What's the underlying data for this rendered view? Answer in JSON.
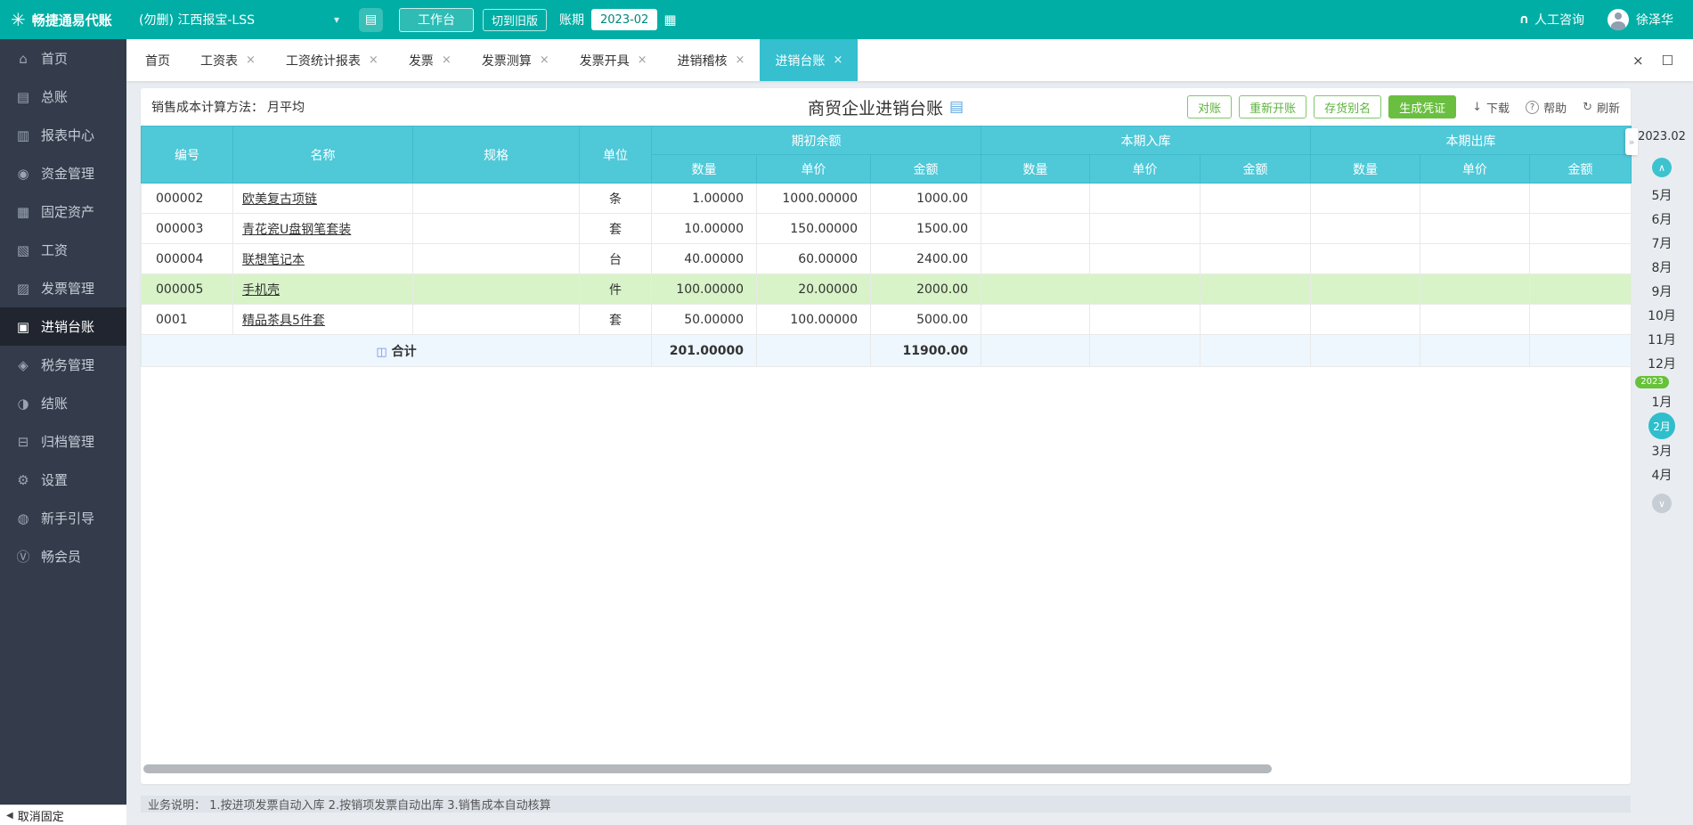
{
  "colors": {
    "brand_teal": "#00aea5",
    "sidebar_dark": "#343c4b",
    "table_header_cyan": "#4fc8d8",
    "active_tab_cyan": "#35bfcf",
    "button_green": "#6abf40",
    "row_highlight_green": "#d7f3c7",
    "total_row_blue": "#edf7fd"
  },
  "icons": {
    "logo": "✳",
    "chevron_down": "▾",
    "note": "▤",
    "calendar": "▦",
    "headset": "∩",
    "close": "×",
    "fullscreen": "☐",
    "download": "↓",
    "help": "?",
    "refresh": "↻",
    "doc": "▤",
    "sum": "◫",
    "collapse": "»",
    "up": "∧",
    "down": "∨",
    "back": "◀"
  },
  "topbar": {
    "logo_text": "畅捷通易代账",
    "company": "(勿删) 江西报宝-LSS",
    "workbench": "工作台",
    "switch_old": "切到旧版",
    "period_label": "账期",
    "period_value": "2023-02",
    "consult": "人工咨询",
    "username": "徐泽华"
  },
  "sidebar": {
    "items": [
      {
        "label": "首页",
        "glyph": "⌂"
      },
      {
        "label": "总账",
        "glyph": "▤"
      },
      {
        "label": "报表中心",
        "glyph": "▥"
      },
      {
        "label": "资金管理",
        "glyph": "◉"
      },
      {
        "label": "固定资产",
        "glyph": "▦"
      },
      {
        "label": "工资",
        "glyph": "▧"
      },
      {
        "label": "发票管理",
        "glyph": "▨"
      },
      {
        "label": "进销台账",
        "glyph": "▣"
      },
      {
        "label": "税务管理",
        "glyph": "◈"
      },
      {
        "label": "结账",
        "glyph": "◑"
      },
      {
        "label": "归档管理",
        "glyph": "⊟"
      },
      {
        "label": "设置",
        "glyph": "⚙"
      },
      {
        "label": "新手引导",
        "glyph": "◍"
      },
      {
        "label": "畅会员",
        "glyph": "Ⓥ"
      }
    ],
    "unpin": "取消固定"
  },
  "tabs": [
    {
      "label": "首页"
    },
    {
      "label": "工资表"
    },
    {
      "label": "工资统计报表"
    },
    {
      "label": "发票"
    },
    {
      "label": "发票测算"
    },
    {
      "label": "发票开具"
    },
    {
      "label": "进销稽核"
    },
    {
      "label": "进销台账"
    }
  ],
  "toolbar": {
    "cost_method_label": "销售成本计算方法：",
    "cost_method_value": "月平均",
    "title": "商贸企业进销台账",
    "btn_reconcile": "对账",
    "btn_reopen": "重新开账",
    "btn_alias": "存货别名",
    "btn_voucher": "生成凭证",
    "download": "下载",
    "help": "帮助",
    "refresh": "刷新"
  },
  "table": {
    "col_code": "编号",
    "col_name": "名称",
    "col_spec": "规格",
    "col_unit": "单位",
    "group_opening": "期初余额",
    "group_in": "本期入库",
    "group_out": "本期出库",
    "sub_qty": "数量",
    "sub_price": "单价",
    "sub_amount": "金额",
    "rows": [
      {
        "code": "000002",
        "name": "欧美复古项链",
        "spec": "",
        "unit": "条",
        "qty": "1.00000",
        "price": "1000.00000",
        "amount": "1000.00"
      },
      {
        "code": "000003",
        "name": "青花瓷U盘钢笔套装",
        "spec": "",
        "unit": "套",
        "qty": "10.00000",
        "price": "150.00000",
        "amount": "1500.00"
      },
      {
        "code": "000004",
        "name": "联想笔记本",
        "spec": "",
        "unit": "台",
        "qty": "40.00000",
        "price": "60.00000",
        "amount": "2400.00"
      },
      {
        "code": "000005",
        "name": "手机壳",
        "spec": "",
        "unit": "件",
        "qty": "100.00000",
        "price": "20.00000",
        "amount": "2000.00"
      },
      {
        "code": "0001",
        "name": "精品茶具5件套",
        "spec": "",
        "unit": "套",
        "qty": "50.00000",
        "price": "100.00000",
        "amount": "5000.00"
      }
    ],
    "total_label": "合计",
    "total_qty": "201.00000",
    "total_amount": "11900.00"
  },
  "month_rail": {
    "current": "2023.02",
    "year_badge": "2023",
    "months": [
      "5月",
      "6月",
      "7月",
      "8月",
      "9月",
      "10月",
      "11月",
      "12月",
      "1月",
      "2月",
      "3月",
      "4月"
    ]
  },
  "footer": {
    "note": "业务说明： 1.按进项发票自动入库  2.按销项发票自动出库  3.销售成本自动核算"
  }
}
